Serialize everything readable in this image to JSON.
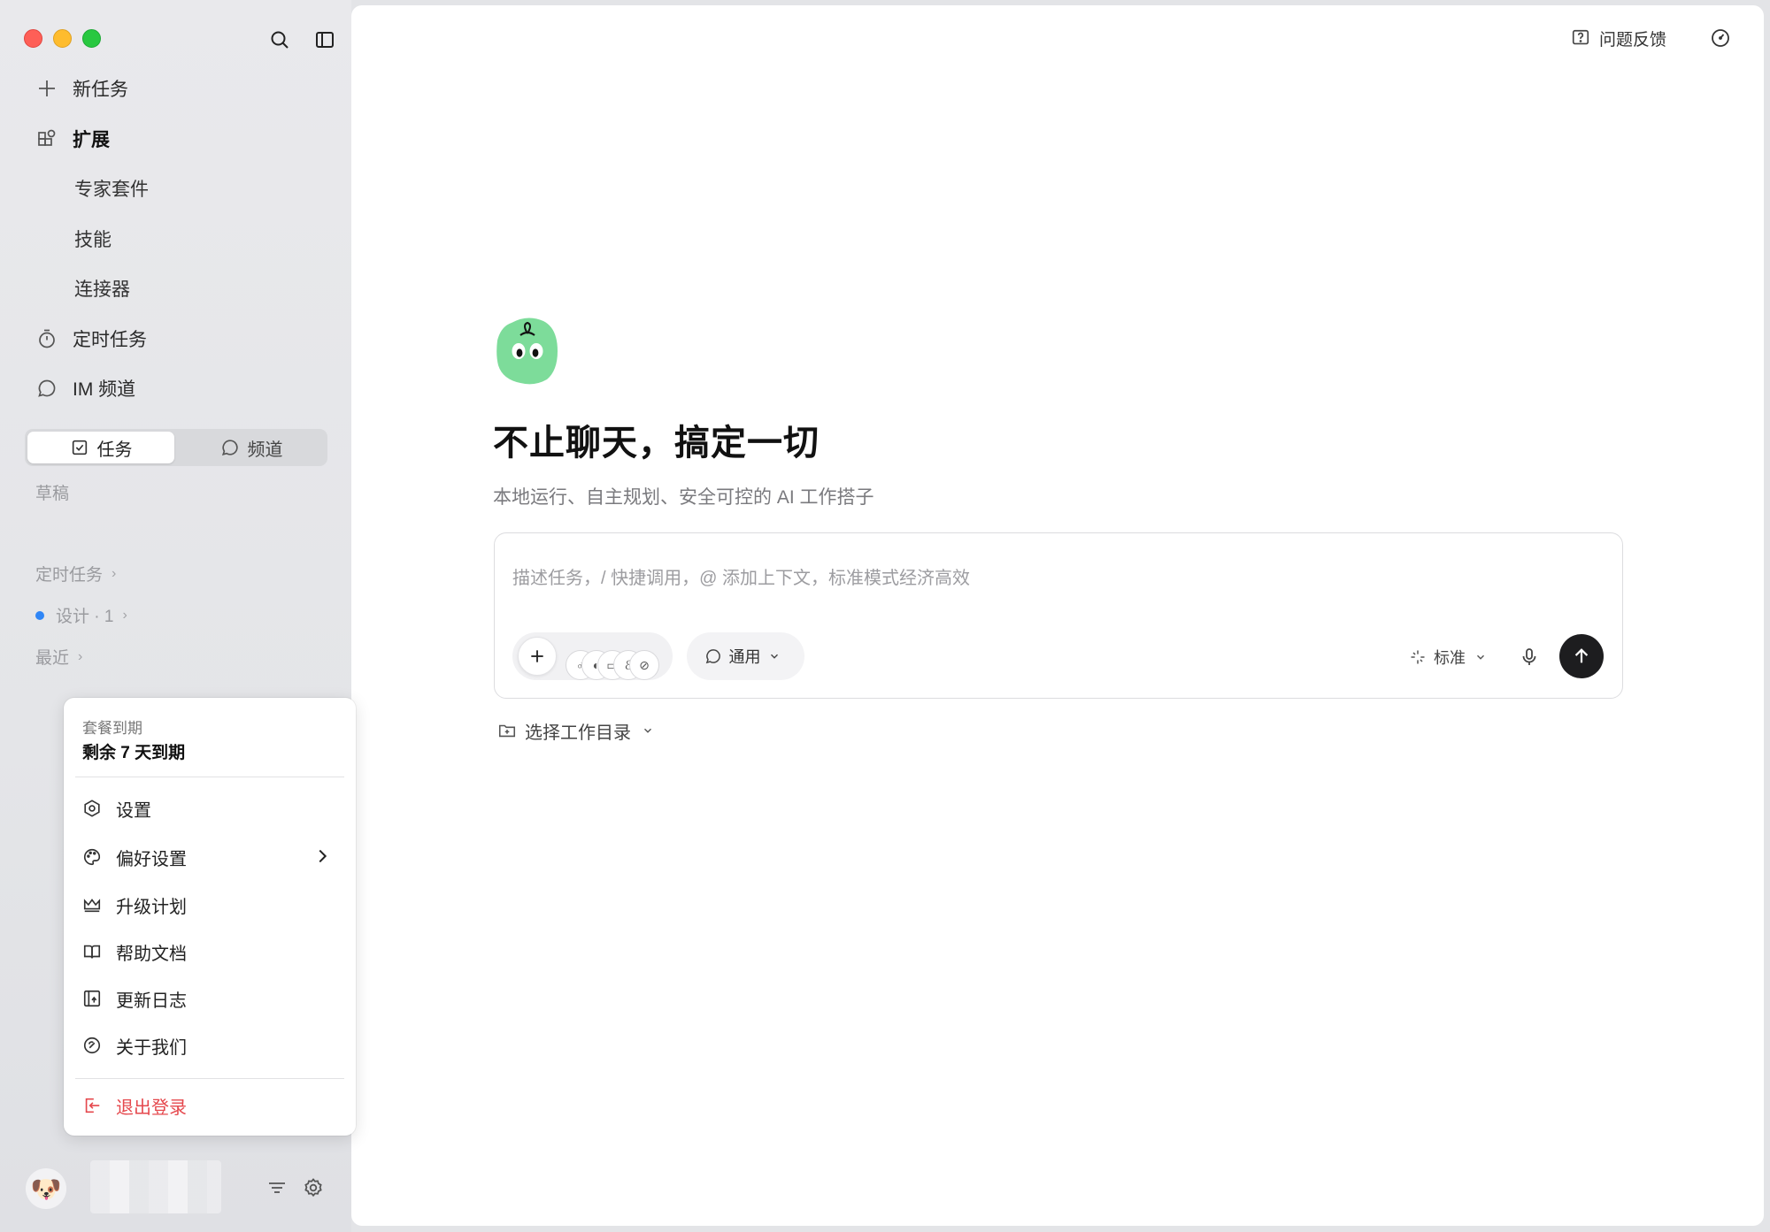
{
  "sidebar": {
    "nav": {
      "new_task": "新任务",
      "extensions": "扩展",
      "sub_experts": "专家套件",
      "sub_skills": "技能",
      "sub_connectors": "连接器",
      "scheduled": "定时任务",
      "im_channel": "IM 频道"
    },
    "segment": {
      "tasks": "任务",
      "channels": "频道",
      "selected": "任务"
    },
    "drafts_label": "草稿",
    "groups": {
      "scheduled": "定时任务",
      "design": "设计 · 1",
      "recent": "最近"
    }
  },
  "popup": {
    "plan_title": "套餐到期",
    "plan_sub": "剩余 7 天到期",
    "items": {
      "settings": "设置",
      "preferences": "偏好设置",
      "upgrade": "升级计划",
      "help": "帮助文档",
      "changelog": "更新日志",
      "about": "关于我们",
      "logout": "退出登录"
    }
  },
  "header": {
    "feedback": "问题反馈"
  },
  "hero": {
    "title": "不止聊天，搞定一切",
    "subtitle": "本地运行、自主规划、安全可控的 AI 工作搭子"
  },
  "composer": {
    "placeholder": "描述任务，/ 快捷调用，@ 添加上下文，标准模式经济高效",
    "mode": "通用",
    "model": "标准"
  },
  "workdir": "选择工作目录",
  "colors": {
    "danger": "#e5484d",
    "accent_blue": "#2f86f6",
    "send_bg": "#1d1d1f",
    "logo_green": "#7ddc9a"
  }
}
